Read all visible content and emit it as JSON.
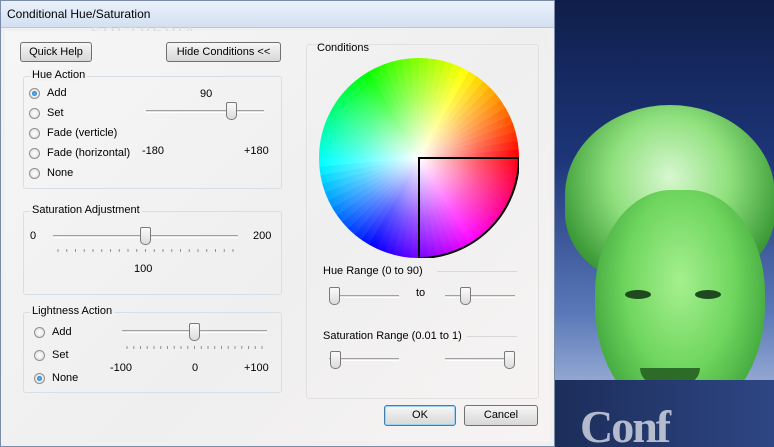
{
  "window": {
    "title": "Conditional Hue/Saturation",
    "watermark": "SOFTPEDIA"
  },
  "buttons": {
    "quick_help": "Quick Help",
    "hide_conditions": "Hide Conditions <<",
    "ok": "OK",
    "cancel": "Cancel"
  },
  "hue_action": {
    "label": "Hue Action",
    "options": [
      "Add",
      "Set",
      "Fade (verticle)",
      "Fade (horizontal)",
      "None"
    ],
    "selected": "Add",
    "value": "90",
    "min": "-180",
    "max": "+180",
    "level": 0.75
  },
  "saturation_adjustment": {
    "label": "Saturation Adjustment",
    "min": "0",
    "max": "200",
    "value": "100",
    "level": 0.5
  },
  "lightness_action": {
    "label": "Lightness Action",
    "options": [
      "Add",
      "Set",
      "None"
    ],
    "selected": "None",
    "min": "-100",
    "mid": "0",
    "max": "+100",
    "level": 0.5
  },
  "conditions": {
    "label": "Conditions",
    "hue_range": {
      "label": "Hue Range (0 to 90)",
      "to": "to",
      "from_level": 0.0,
      "to_level": 0.25
    },
    "saturation_range": {
      "label": "Saturation Range (0.01 to 1)",
      "from_level": 0.01,
      "to_level": 1.0
    }
  },
  "colors": {
    "selected_radio": "#0b5fb0",
    "group_border": "#d5dfe5"
  },
  "icons": {
    "radio": "radio-button",
    "wheel": "color-wheel"
  }
}
